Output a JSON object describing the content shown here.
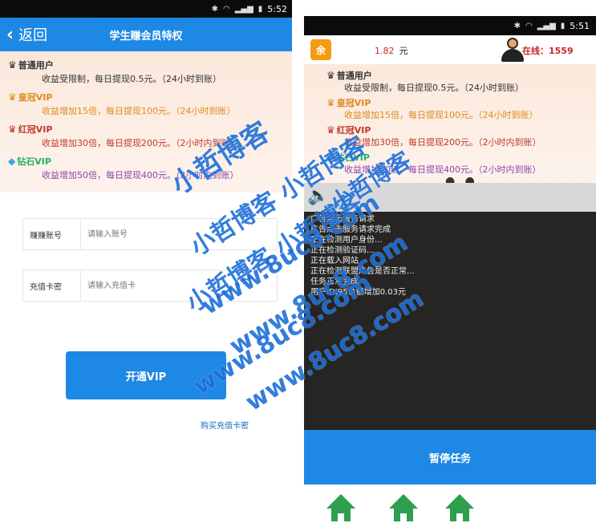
{
  "left": {
    "status": {
      "time": "5:52",
      "icons": [
        "bluetooth-icon",
        "wifi-icon",
        "signal-icon",
        "battery-icon"
      ]
    },
    "header": {
      "back_label": "返回",
      "title": "学生赚会员特权"
    },
    "tiers": [
      {
        "name": "普通用户",
        "desc": "收益受限制，每日提现0.5元。（24小时到账）",
        "color": "#333333",
        "icon": "crown-gray-icon"
      },
      {
        "name": "皇冠VIP",
        "desc": "收益增加15倍，每日提现100元。（24小时到账）",
        "color": "#e08a1e",
        "icon": "crown-gold-icon"
      },
      {
        "name": "红冠VIP",
        "desc": "收益增加30倍，每日提现200元。（2小时内到账）",
        "color": "#c0392b",
        "icon": "crown-red-icon"
      },
      {
        "name": "钻石VIP",
        "desc": "收益增加50倍，每日提现400元。（2小时内到账）",
        "color": "#8e44ad",
        "icon": "diamond-icon"
      }
    ],
    "form": {
      "account_label": "赚赚账号",
      "account_placeholder": "请输入账号",
      "card_label": "充值卡密",
      "card_placeholder": "请输入充值卡"
    },
    "vip_button": "开通VIP",
    "buy_link": "购买充值卡密"
  },
  "right": {
    "status": {
      "time": "5:51"
    },
    "app_icon_text": "余",
    "balance": {
      "value": "1.82",
      "unit": "元"
    },
    "online": "在线：1559",
    "tiers": [
      {
        "name": "普通用户",
        "desc": "收益受限制，每日提现0.5元。（24小时到账）",
        "color": "#333333"
      },
      {
        "name": "皇冠VIP",
        "desc": "收益增加15倍，每日提现100元。（24小时到账）",
        "color": "#e08a1e"
      },
      {
        "name": "红冠VIP",
        "desc": "收益增加30倍，每日提现200元。（2小时内到账）",
        "color": "#c0392b"
      },
      {
        "name": "钻石VIP",
        "desc": "收益增加50倍，每日提现400元。（2小时内到账）",
        "color": "#8e44ad"
      }
    ],
    "pager_dots": "● ●",
    "log_lines": [
      "广告点击服务请求",
      "广告点击服务请求完成",
      "正在检测用户身份...",
      "正在检测验证码...",
      "正在载入网站",
      "正在检测联盟广告是否正常...",
      "任务正常完成",
      "用户ID:95余额增加0.03元"
    ],
    "pause_button": "暂停任务"
  },
  "watermarks": [
    "小哲博客",
    "小哲博客 小哲博客",
    "小哲博客 小哲博客",
    "小哲博客",
    "www.8uc8.com",
    "www.8uc8.com",
    "www.8uc8.com",
    "www.8uc8.com"
  ]
}
